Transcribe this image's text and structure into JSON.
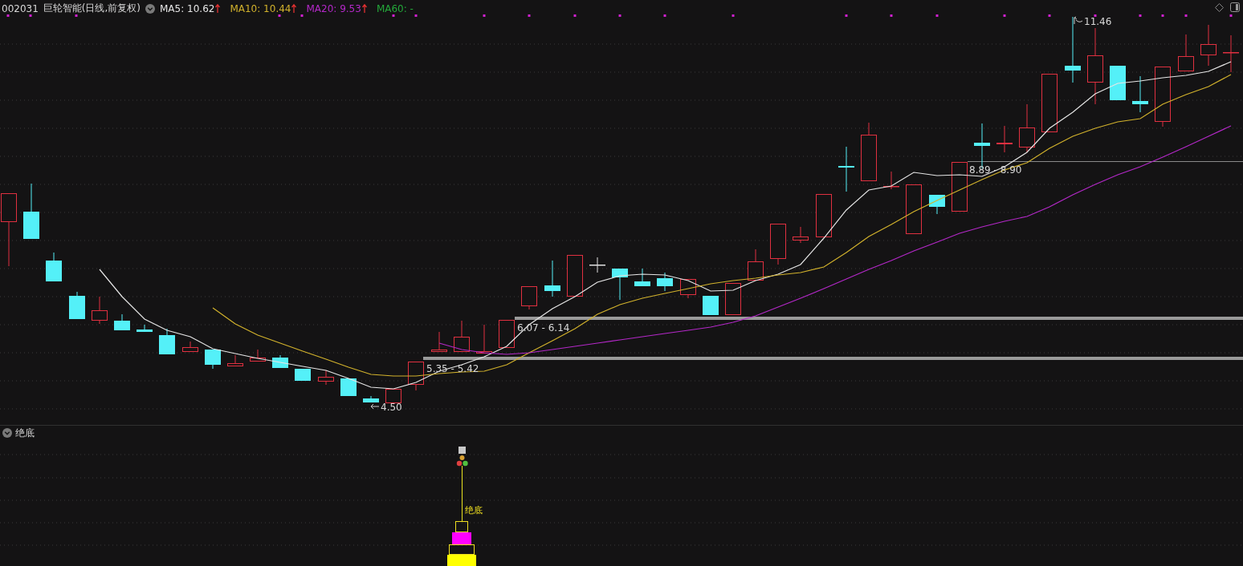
{
  "header": {
    "code": "002031",
    "title": "巨轮智能(日线,前复权)",
    "indicators": [
      {
        "label": "MA5: 10.62",
        "color": "#e6e6e6",
        "rising": true
      },
      {
        "label": "MA10: 10.44",
        "color": "#d2b22c",
        "rising": true
      },
      {
        "label": "MA20: 9.53",
        "color": "#b428c8",
        "rising": true
      },
      {
        "label": "MA60: -",
        "color": "#24a83a",
        "rising": false
      }
    ]
  },
  "chart": {
    "high_label": "11.46",
    "low_label": "4.50",
    "zones": [
      "5.35 - 5.42",
      "6.07 - 6.14",
      "8.89 - 8.90"
    ]
  },
  "sub_panel": {
    "title": "绝底",
    "signal_label": "绝底"
  }
}
